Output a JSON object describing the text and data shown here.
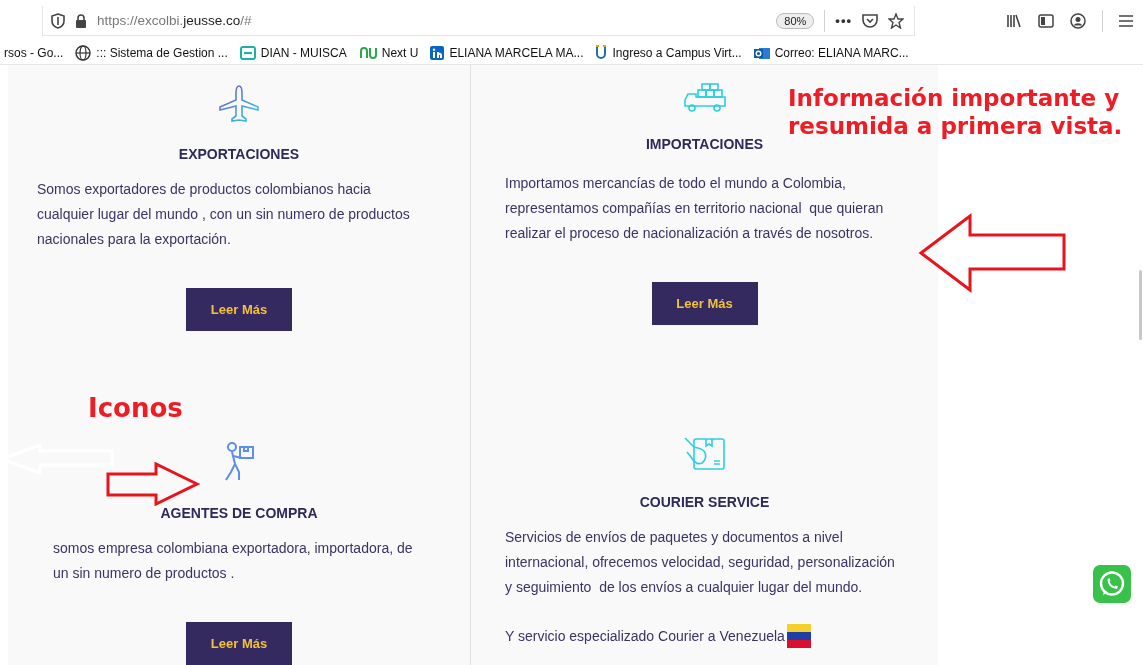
{
  "browser": {
    "url": {
      "scheme": "https://excolbi.",
      "domain": "jeusse.co",
      "path": "/#"
    },
    "zoom": "80%",
    "more": "•••"
  },
  "bookmarks": [
    {
      "kind": "cut",
      "label": "rsos - Go..."
    },
    {
      "kind": "globe",
      "label": "::: Sistema de Gestion ..."
    },
    {
      "kind": "dian",
      "label": "DIAN - MUISCA"
    },
    {
      "kind": "nextu",
      "label": "Next U"
    },
    {
      "kind": "linkedin",
      "label": "ELIANA MARCELA MA..."
    },
    {
      "kind": "campus",
      "label": "Ingreso a Campus Virt..."
    },
    {
      "kind": "outlook",
      "label": "Correo: ELIANA MARC..."
    }
  ],
  "columns": [
    [
      {
        "kind": "plane",
        "title": "EXPORTACIONES",
        "paragraphs": [
          [
            "Somos exportadores de productos colombianos hacia",
            "cualquier lugar del mundo , con un sin numero de productos",
            "nacionales para la exportación."
          ]
        ],
        "button": "Leer Más"
      },
      {
        "kind": "walker",
        "title": "AGENTES DE COMPRA",
        "paragraphs": [
          [
            "somos empresa colombiana exportadora, importadora, de",
            "un sin numero de productos ."
          ]
        ],
        "button": "Leer Más"
      }
    ],
    [
      {
        "kind": "truck",
        "title": "IMPORTACIONES",
        "paragraphs": [
          [
            "Importamos mercancías de todo el mundo a Colombia,",
            "representamos compañías en territorio nacional  que quieran",
            "realizar el proceso de nacionalización a través de nosotros."
          ]
        ],
        "button": "Leer Más"
      },
      {
        "kind": "handbox",
        "title": "COURIER SERVICE",
        "paragraphs": [
          [
            "Servicios de envíos de paquetes y documentos a nivel",
            "internacional, ofrecemos velocidad, seguridad, personalización",
            "y seguimiento  de los envíos a cualquier lugar del mundo."
          ],
          [
            "Y servicio especializado Courier a Venezuela"
          ]
        ],
        "venezuela_flag": true
      }
    ]
  ],
  "annotations": {
    "headline": "Información importante y resumida a primera vista.",
    "icons_note": "Iconos"
  }
}
